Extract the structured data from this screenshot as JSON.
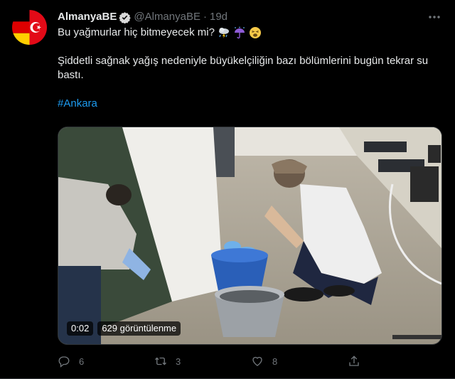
{
  "tweet": {
    "author_name": "AlmanyaBE",
    "handle": "@AlmanyaBE",
    "separator": "·",
    "time": "19d",
    "line1": "Bu yağmurlar hiç bitmeyecek mi?",
    "line2": "Şiddetli sağnak yağış nedeniyle büyükelçiliğin bazı bölümlerini bugün tekrar su bastı.",
    "hashtag": "#Ankara"
  },
  "video": {
    "duration": "0:02",
    "views": "629 görüntülenme"
  },
  "actions": {
    "reply_count": "6",
    "retweet_count": "3",
    "like_count": "8"
  },
  "colors": {
    "background": "#000000",
    "text": "#e7e9ea",
    "muted": "#71767b",
    "accent": "#1d9bf0"
  },
  "icons": [
    "verified-badge-icon",
    "more-icon",
    "storm-emoji",
    "umbrella-rain-emoji",
    "weary-face-emoji",
    "reply-icon",
    "retweet-icon",
    "like-icon",
    "share-icon"
  ]
}
